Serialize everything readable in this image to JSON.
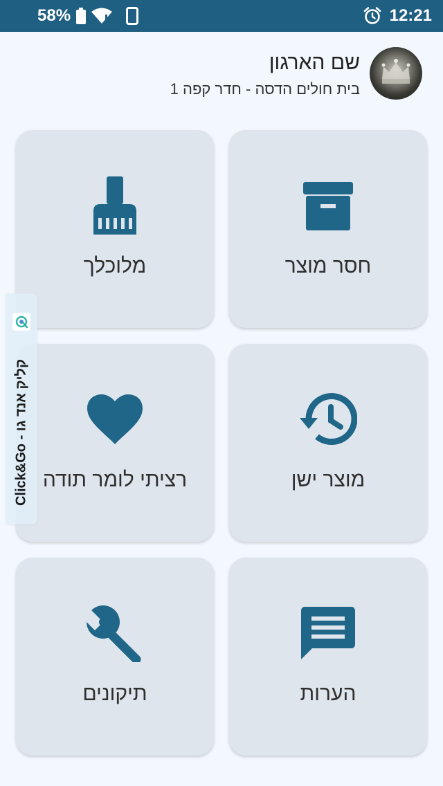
{
  "status_bar": {
    "battery_percent": "58%",
    "time": "12:21",
    "icons": [
      "battery-icon",
      "wifi-icon",
      "phone-icon",
      "alarm-icon"
    ]
  },
  "header": {
    "org_name": "שם הארגון",
    "org_location": "בית חולים הדסה - חדר קפה 1"
  },
  "tiles": [
    {
      "id": "missing-product",
      "label": "חסר מוצר",
      "icon": "archive-box-icon"
    },
    {
      "id": "dirty",
      "label": "מלוכלך",
      "icon": "broom-icon"
    },
    {
      "id": "old-product",
      "label": "מוצר ישן",
      "icon": "history-icon"
    },
    {
      "id": "thanks",
      "label": "רציתי לומר תודה",
      "icon": "heart-icon"
    },
    {
      "id": "comments",
      "label": "הערות",
      "icon": "comment-icon"
    },
    {
      "id": "repairs",
      "label": "תיקונים",
      "icon": "wrench-icon"
    }
  ],
  "side_tab": {
    "text": "Click&Go - קליק אנד גו"
  },
  "colors": {
    "primary": "#1f5f82",
    "icon": "#1f6688",
    "tile_bg": "#dfe5ec",
    "page_bg": "#f2f8fd"
  }
}
